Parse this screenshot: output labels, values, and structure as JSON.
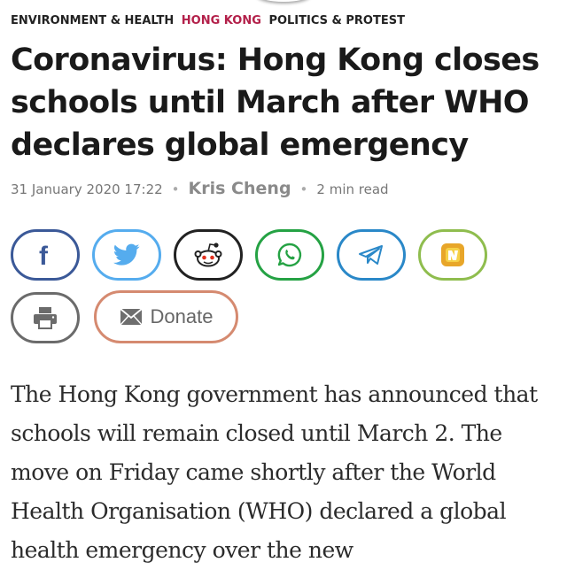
{
  "article": {
    "categories": [
      {
        "label": "ENVIRONMENT & HEALTH",
        "color": "#222222"
      },
      {
        "label": "HONG KONG",
        "color": "#b3204a"
      },
      {
        "label": "POLITICS & PROTEST",
        "color": "#222222"
      }
    ],
    "headline": "Coronavirus: Hong Kong closes schools until March after WHO declares global emergency",
    "meta": {
      "date": "31 January 2020 17:22",
      "author": "Kris Cheng",
      "read_time": "2 min read"
    },
    "body": "The Hong Kong government has announced that schools will remain closed until March 2. The move on Friday came shortly after the World Health Organisation (WHO) declared a global health emergency over the new"
  },
  "share": {
    "buttons": [
      {
        "name": "facebook",
        "icon": "facebook-icon",
        "color": "#3b5998"
      },
      {
        "name": "twitter",
        "icon": "twitter-icon",
        "color": "#55acee"
      },
      {
        "name": "reddit",
        "icon": "reddit-icon",
        "color": "#222222"
      },
      {
        "name": "whatsapp",
        "icon": "whatsapp-icon",
        "color": "#25a244"
      },
      {
        "name": "telegram",
        "icon": "telegram-icon",
        "color": "#2a88c8"
      },
      {
        "name": "newsblur",
        "icon": "newsblur-icon",
        "color": "#8fbd4e"
      },
      {
        "name": "print",
        "icon": "print-icon",
        "color": "#6b6b6b"
      }
    ],
    "donate_label": "Donate",
    "donate_color": "#d58a70"
  }
}
